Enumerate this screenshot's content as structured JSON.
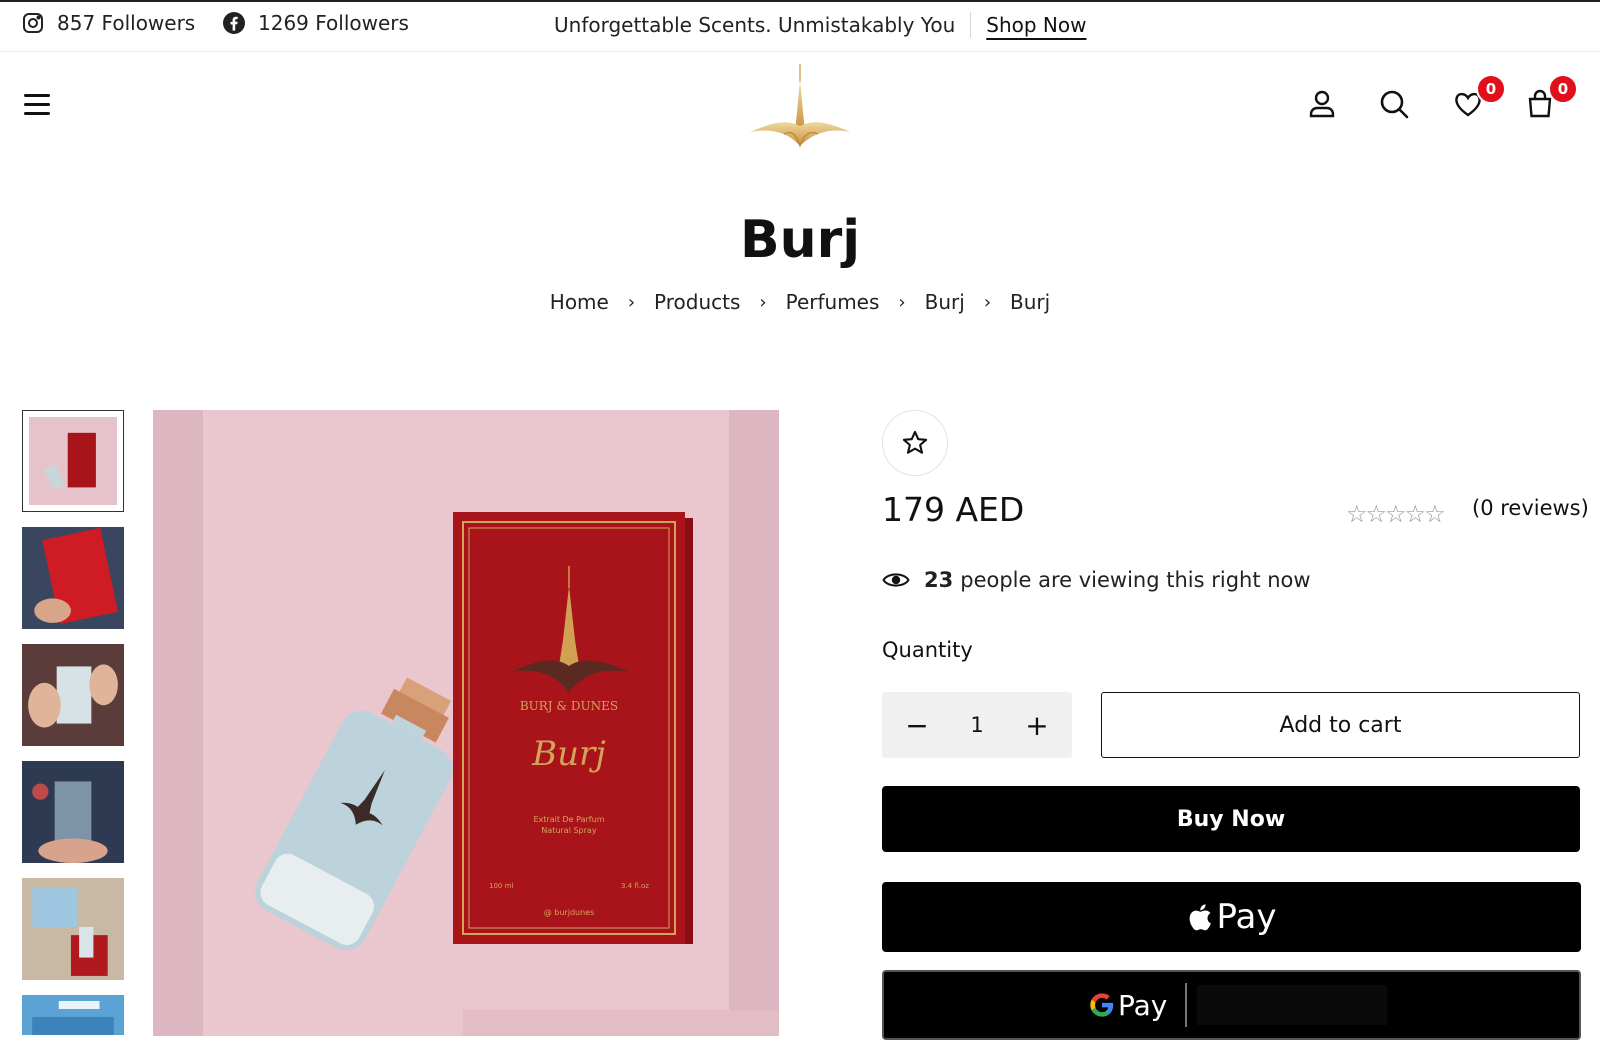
{
  "topbar": {
    "instagram": {
      "icon": "instagram-icon",
      "count": "857",
      "label": "Followers"
    },
    "facebook": {
      "icon": "facebook-icon",
      "count": "1269",
      "label": "Followers"
    },
    "promo_text": "Unforgettable Scents. Unmistakably You",
    "shop_link": "Shop Now"
  },
  "header": {
    "menu_icon": "hamburger-menu-icon",
    "logo": "burj-dunes-logo",
    "account_icon": "user-icon",
    "search_icon": "search-icon",
    "wishlist_icon": "heart-icon",
    "wishlist_count": "0",
    "cart_icon": "shopping-bag-icon",
    "cart_count": "0",
    "badge_color": "#e0111c"
  },
  "page": {
    "title": "Burj",
    "breadcrumb": [
      "Home",
      "Products",
      "Perfumes",
      "Burj",
      "Burj"
    ],
    "breadcrumb_separator": "›"
  },
  "gallery": {
    "thumbnails": [
      "thumb-1",
      "thumb-2",
      "thumb-3",
      "thumb-4",
      "thumb-5",
      "thumb-6"
    ],
    "active_index": 0,
    "main_image": {
      "box_brand": "BURJ & DUNES",
      "box_script": "Burj",
      "box_line1": "Extrait De Parfum",
      "box_line2": "Natural Spray",
      "box_volume": "100 ml",
      "box_volume_oz": "3.4 fl.oz",
      "box_handle": "@ burjdunes",
      "box_color": "#a81419",
      "background_color": "#eac6cf"
    }
  },
  "product": {
    "wishlist_icon": "star-outline-icon",
    "price": "179 AED",
    "rating": 0,
    "rating_max": 5,
    "reviews": "(0 reviews)",
    "viewing_count": "23",
    "viewing_text": "people are viewing this right now",
    "quantity_label": "Quantity",
    "quantity_value": "1",
    "minus": "−",
    "plus": "+",
    "add_to_cart": "Add to cart",
    "buy_now": "Buy Now",
    "apple_pay": "Pay",
    "google_pay": "Pay"
  }
}
